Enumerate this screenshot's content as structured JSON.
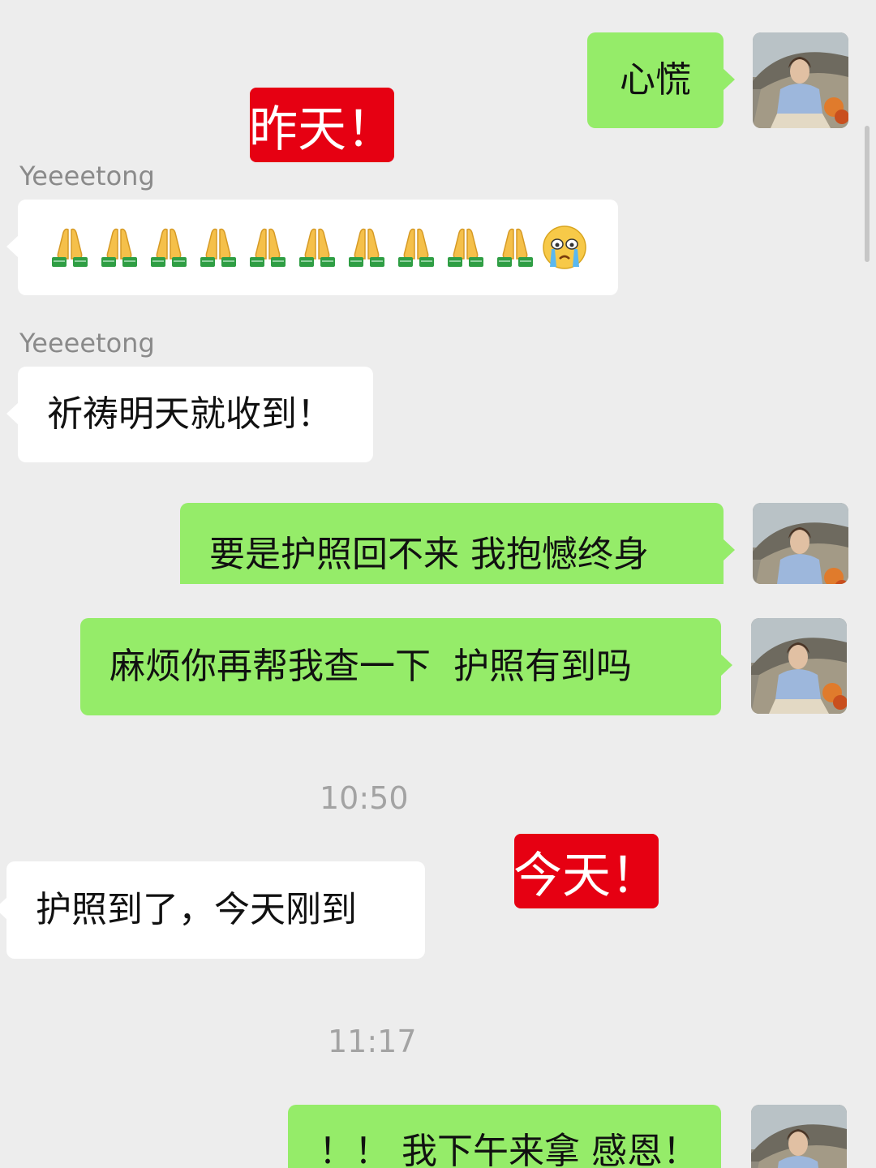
{
  "messages": {
    "m1": {
      "text": "心慌"
    },
    "m2": {
      "sender": "Yeeeetong",
      "emoji": "🙏🙏🙏🙏🙏🙏🙏🙏🙏🙏😭"
    },
    "m3": {
      "sender": "Yeeeetong",
      "text": "祈祷明天就收到！"
    },
    "m4": {
      "text": "要是护照回不来 我抱憾终身"
    },
    "m5": {
      "text": "麻烦你再帮我查一下  护照有到吗"
    },
    "m6": {
      "text": "护照到了，今天刚到"
    },
    "m7": {
      "text": "！！ 我下午来拿 感恩！"
    }
  },
  "timestamps": {
    "t1": "10:50",
    "t2": "11:17"
  },
  "stickers": {
    "yesterday": "昨天！",
    "today": "今天！"
  },
  "colors": {
    "background": "#ededed",
    "my_bubble": "#95ec69",
    "other_bubble": "#ffffff",
    "sticker": "#e60012"
  },
  "icons": {
    "pray": "folded-hands-emoji",
    "cry": "loudly-crying-face-emoji",
    "avatar": "user-photo-avatar"
  }
}
